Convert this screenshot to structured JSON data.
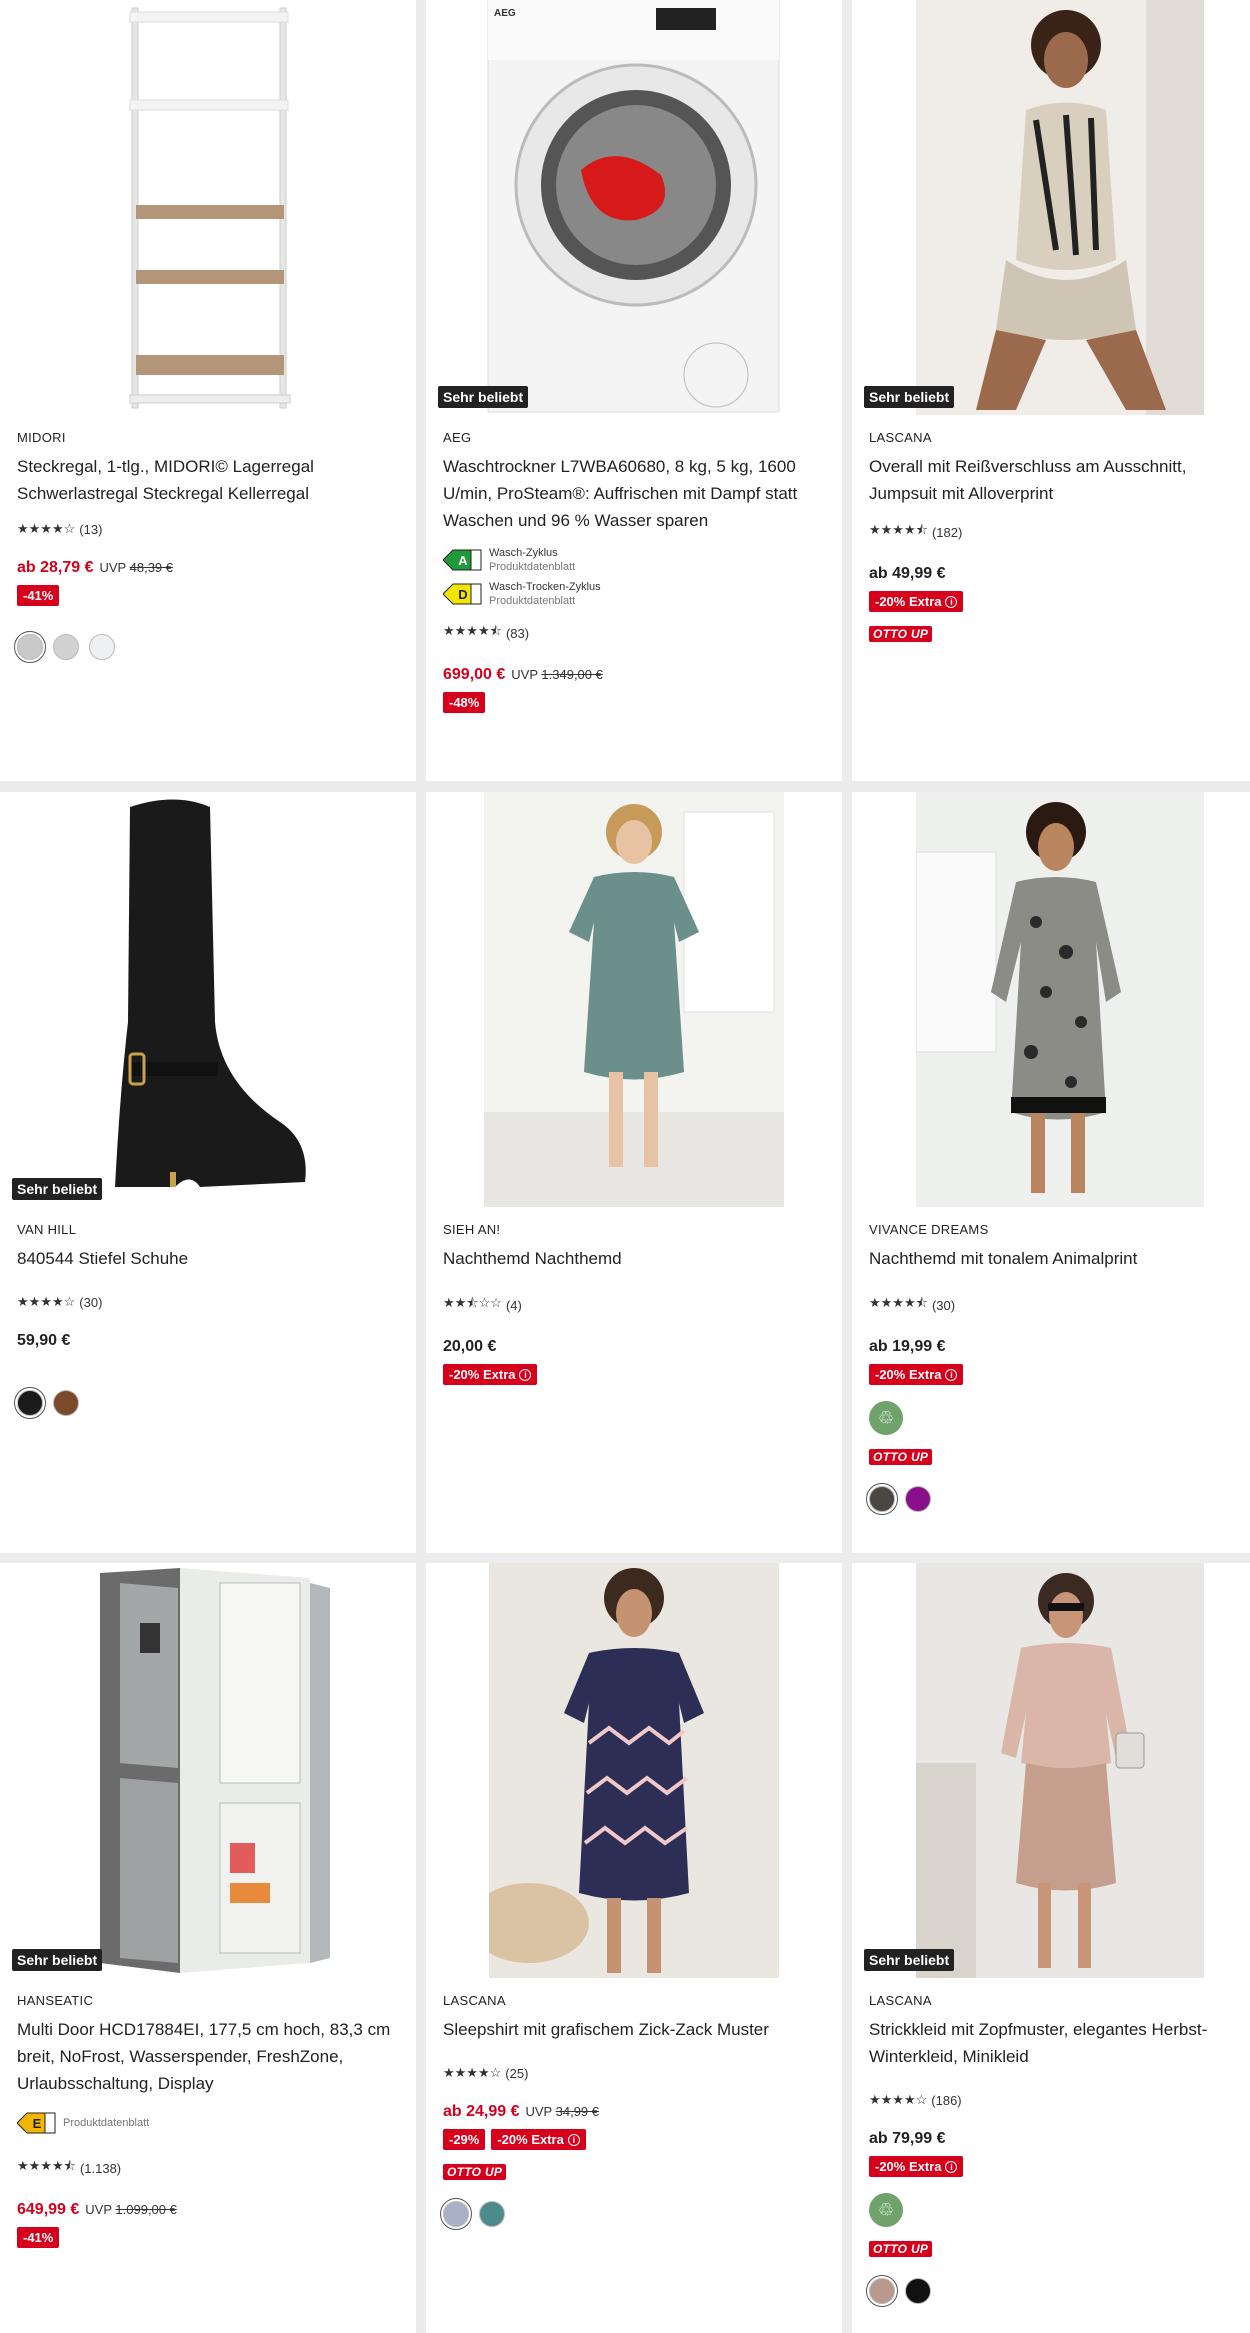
{
  "badge_label": "Sehr beliebt",
  "uvp_label": "UVP",
  "otto_up_label": "OTTO UP",
  "products": [
    {
      "brand": "MIDORI",
      "title": "Steckregal, 1-tlg., MIDORI© Lagerregal Schwerlastregal Steckregal Kellerregal",
      "stars": "★★★★☆",
      "rating_value": 4,
      "review_count": "(13)",
      "price": "ab 28,79 €",
      "price_is_sale": true,
      "old_price": "48,39 €",
      "discount": "-41%",
      "image_alt": "shelf",
      "colors": [
        "#c9c9c9",
        "#d2d2d2",
        "#eef0f1"
      ]
    },
    {
      "brand": "AEG",
      "title": "Waschtrockner L7WBA60680, 8 kg, 5 kg, 1600 U/min, ProSteam®: Auffrischen mit Dampf statt Waschen und 96 % Wasser sparen",
      "badge": true,
      "energy": [
        {
          "class": "A",
          "color": "#1f9a3a",
          "label": "Wasch-Zyklus",
          "sub": "Produktdatenblatt"
        },
        {
          "class": "D",
          "color": "#f2e600",
          "label": "Wasch-Trocken-Zyklus",
          "sub": "Produktdatenblatt"
        }
      ],
      "stars": "★★★★⯪",
      "rating_value": 4.5,
      "review_count": "(83)",
      "price": "699,00 €",
      "price_is_sale": true,
      "old_price": "1.349,00 €",
      "discount": "-48%",
      "image_alt": "washer-dryer"
    },
    {
      "brand": "LASCANA",
      "title": "Overall mit Reißverschluss am Ausschnitt, Jumpsuit mit Alloverprint",
      "badge": true,
      "stars": "★★★★⯪",
      "rating_value": 4.5,
      "review_count": "(182)",
      "price": "ab 49,99 €",
      "extra": "-20% Extra",
      "otto_up": true,
      "image_alt": "jumpsuit"
    },
    {
      "brand": "VAN HILL",
      "title": "840544 Stiefel Schuhe",
      "badge": true,
      "stars": "★★★★☆",
      "rating_value": 4,
      "review_count": "(30)",
      "price": "59,90 €",
      "colors": [
        "#1b1b1b",
        "#7a4a2a"
      ],
      "image_alt": "boot"
    },
    {
      "brand": "SIEH AN!",
      "title": "Nachthemd Nachthemd",
      "stars": "★★⯪☆☆",
      "rating_value": 2.5,
      "review_count": "(4)",
      "price": "20,00 €",
      "extra": "-20% Extra",
      "image_alt": "nightdress"
    },
    {
      "brand": "VIVANCE DREAMS",
      "title": "Nachthemd mit tonalem Animalprint",
      "stars": "★★★★⯪",
      "rating_value": 4.5,
      "review_count": "(30)",
      "price": "ab 19,99 €",
      "extra": "-20% Extra",
      "sustainable": true,
      "otto_up": true,
      "colors": [
        "#4a4642",
        "#8a0f8a"
      ],
      "image_alt": "animal-print-dress"
    },
    {
      "brand": "HANSEATIC",
      "title": "Multi Door HCD17884EI, 177,5 cm hoch, 83,3 cm breit, NoFrost, Wasserspender, FreshZone, Urlaubsschaltung, Display",
      "badge": true,
      "energy": [
        {
          "class": "E",
          "color": "#f2b600",
          "label": "Produktdatenblatt",
          "sub": ""
        }
      ],
      "stars": "★★★★⯪",
      "rating_value": 4.5,
      "review_count": "(1.138)",
      "price": "649,99 €",
      "price_is_sale": true,
      "old_price": "1.099,00 €",
      "discount": "-41%",
      "image_alt": "fridge"
    },
    {
      "brand": "LASCANA",
      "title": "Sleepshirt mit grafischem Zick-Zack Muster",
      "stars": "★★★★☆",
      "rating_value": 4,
      "review_count": "(25)",
      "price": "ab 24,99 €",
      "price_is_sale": true,
      "old_price": "34,99 €",
      "discount": "-29%",
      "extra": "-20% Extra",
      "otto_up": true,
      "colors": [
        "#a9b1c8",
        "#4d8a8a"
      ],
      "image_alt": "sleepshirt"
    },
    {
      "brand": "LASCANA",
      "title": "Strickkleid mit Zopfmuster, elegantes Herbst-Winterkleid, Minikleid",
      "badge": true,
      "stars": "★★★★☆",
      "rating_value": 4,
      "review_count": "(186)",
      "price": "ab 79,99 €",
      "extra": "-20% Extra",
      "sustainable": true,
      "otto_up": true,
      "colors": [
        "#b8998b",
        "#111111"
      ],
      "image_alt": "knit-dress"
    }
  ]
}
